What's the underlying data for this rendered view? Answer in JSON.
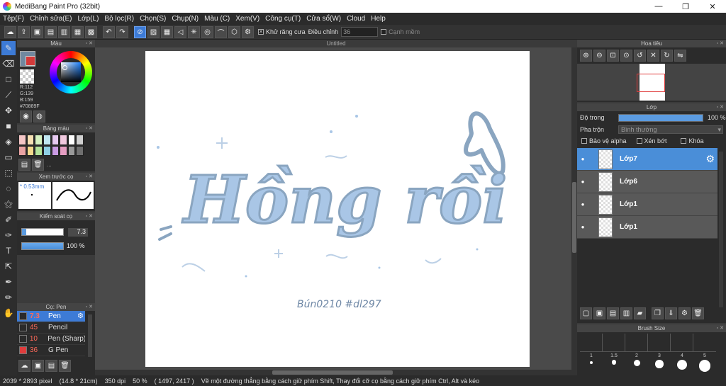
{
  "window": {
    "title": "MediBang Paint Pro (32bit)",
    "minimize": "—",
    "restore": "❐",
    "close": "✕"
  },
  "menu": [
    "Tệp(F)",
    "Chỉnh sửa(E)",
    "Lớp(L)",
    "Bộ lọc(R)",
    "Chọn(S)",
    "Chụp(N)",
    "Màu (C)",
    "Xem(V)",
    "Công cụ(T)",
    "Cửa sổ(W)",
    "Cloud",
    "Help"
  ],
  "toolbar": {
    "antialias_label": "Khử răng cưa",
    "correction_label": "Điều chỉnh",
    "correction_value": "36",
    "edge_label": "Cạnh mềm"
  },
  "color_panel": {
    "title": "Màu",
    "r": "R:112",
    "g": "G:139",
    "b": "B:159",
    "hex": "#70889F",
    "main_color": "#70889f",
    "sub_color": "#d33a3a"
  },
  "palette_panel": {
    "title": "Bảng màu",
    "more": "..."
  },
  "preview_panel": {
    "title": "Xem trước cọ",
    "size": "* 0.53mm"
  },
  "brush_control": {
    "title": "Kiểm soát cọ",
    "size_value": "7.3",
    "opacity_value": "100 %"
  },
  "brush_panel": {
    "title": "Cọ: Pen",
    "brushes": [
      {
        "size": "7.3",
        "name": "Pen",
        "color": "#2a2a2a"
      },
      {
        "size": "45",
        "name": "Pencil",
        "color": "#2a2a2a"
      },
      {
        "size": "10",
        "name": "Pen (Sharp)",
        "color": "#2a2a2a"
      },
      {
        "size": "36",
        "name": "G Pen",
        "color": "#e03c3c"
      }
    ]
  },
  "document": {
    "title": "Untitled",
    "artwork_text": "Hồng rồi",
    "signature": "Bún0210 #dl297"
  },
  "navigator": {
    "title": "Hoa tiêu"
  },
  "layer_panel": {
    "title": "Lớp",
    "opacity_label": "Độ trong",
    "opacity_value": "100 %",
    "opacity_fraction": 1.0,
    "blend_label": "Pha trộn",
    "blend_value": "Bình thường",
    "protect_alpha": "Bảo vệ alpha",
    "clipping": "Xén bớt",
    "lock": "Khóa",
    "layers": [
      {
        "name": "Lớp7"
      },
      {
        "name": "Lớp6"
      },
      {
        "name": "Lớp1"
      },
      {
        "name": "Lớp1"
      }
    ]
  },
  "brush_size_panel": {
    "title": "Brush Size",
    "sizes": [
      "1",
      "1.5",
      "2",
      "3",
      "4",
      "5"
    ]
  },
  "status": {
    "dimensions": "2039 * 2893 pixel",
    "physical": "(14.8 * 21cm)",
    "dpi": "350 dpi",
    "zoom": "50 %",
    "coords": "( 1497, 2417 )",
    "hint": "Vẽ một đường thẳng bằng cách giữ phím Shift, Thay đổi cỡ cọ bằng cách giữ phím Ctrl, Alt và kéo"
  },
  "colors": {
    "accent": "#3d7bd6",
    "stroke_blue": "#a9c6e6",
    "stroke_dark": "#8aa5c0"
  }
}
